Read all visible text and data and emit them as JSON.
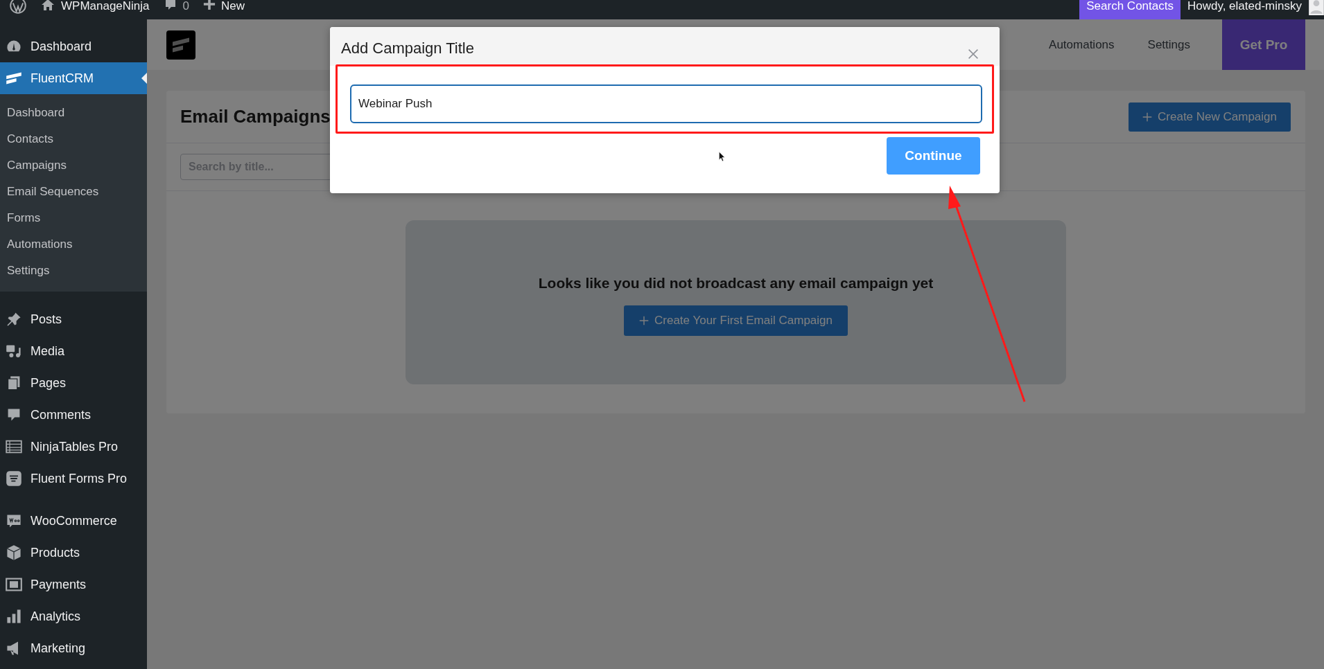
{
  "admin_bar": {
    "site_name": "WPManageNinja",
    "comments_count": "0",
    "new_label": "New",
    "search_contacts": "Search Contacts",
    "greeting": "Howdy, elated-minsky"
  },
  "sidebar": {
    "groups": [
      {
        "items": [
          {
            "label": "Dashboard",
            "kind": "dashboard",
            "selected": false
          },
          {
            "label": "FluentCRM",
            "kind": "fluentcrm",
            "selected": true,
            "children": [
              {
                "label": "Dashboard"
              },
              {
                "label": "Contacts"
              },
              {
                "label": "Campaigns"
              },
              {
                "label": "Email Sequences"
              },
              {
                "label": "Forms"
              },
              {
                "label": "Automations"
              },
              {
                "label": "Settings"
              }
            ]
          }
        ]
      },
      {
        "items": [
          {
            "label": "Posts",
            "kind": "posts",
            "selected": false
          },
          {
            "label": "Media",
            "kind": "media",
            "selected": false
          },
          {
            "label": "Pages",
            "kind": "pages",
            "selected": false
          },
          {
            "label": "Comments",
            "kind": "comments",
            "selected": false
          },
          {
            "label": "NinjaTables Pro",
            "kind": "table",
            "selected": false
          },
          {
            "label": "Fluent Forms Pro",
            "kind": "forms",
            "selected": false
          }
        ]
      },
      {
        "items": [
          {
            "label": "WooCommerce",
            "kind": "woo",
            "selected": false
          },
          {
            "label": "Products",
            "kind": "products",
            "selected": false
          },
          {
            "label": "Payments",
            "kind": "payments",
            "selected": false
          },
          {
            "label": "Analytics",
            "kind": "analytics",
            "selected": false
          },
          {
            "label": "Marketing",
            "kind": "marketing",
            "selected": false
          }
        ]
      }
    ]
  },
  "crm_header": {
    "nav": [
      {
        "label": "Automations",
        "selected": false
      },
      {
        "label": "Settings",
        "selected": false
      }
    ],
    "upgrade_button": "Get Pro"
  },
  "campaigns": {
    "title": "Email Campaigns",
    "create_button": "Create New Campaign",
    "search": {
      "placeholder": "Search by title..."
    },
    "empty_message": "Looks like you did not broadcast any email campaign yet",
    "empty_button": "Create Your First Email Campaign"
  },
  "modal": {
    "title": "Add Campaign Title",
    "input": {
      "value": "Webinar Push"
    },
    "continue_button": "Continue"
  }
}
